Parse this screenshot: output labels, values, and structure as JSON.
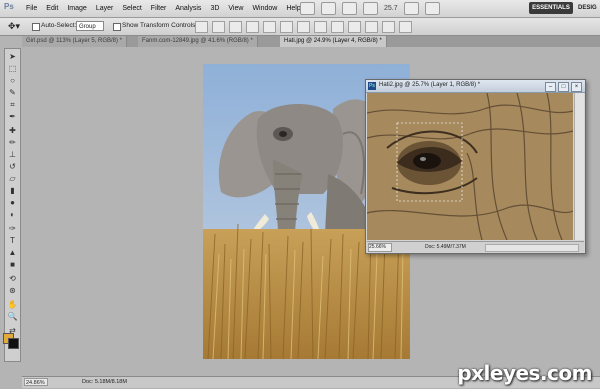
{
  "app": {
    "logo": "Ps"
  },
  "menu": [
    "File",
    "Edit",
    "Image",
    "Layer",
    "Select",
    "Filter",
    "Analysis",
    "3D",
    "View",
    "Window",
    "Help"
  ],
  "menu_zoom": "25.7",
  "workspace": {
    "active": "ESSENTIALS",
    "next": "DESIG"
  },
  "options": {
    "auto_select_label": "Auto-Select:",
    "auto_select_value": "Group",
    "transform_label": "Show Transform Controls"
  },
  "tabs": [
    "Girl.psd @ 113% (Layer 5, RGB/8) *",
    "Fanm.com-12849.jpg @ 41.6% (RGB/8) *",
    "Hati.jpg @ 24.9% (Layer 4, RGB/8) *"
  ],
  "main_status": {
    "zoom": "24.86%",
    "doc": "Doc: 5.18M/8.18M"
  },
  "sub_window": {
    "title": "Hati2.jpg @ 25.7% (Layer 1, RGB/8) *",
    "zoom": "25.66%",
    "doc": "Doc: 5.49M/7.37M"
  },
  "colors": {
    "foreground": "#e2a93b",
    "background": "#111111",
    "essentials_bg": "#3a3a3a"
  },
  "icons": [
    "move-tool-icon",
    "marquee-tool-icon",
    "lasso-tool-icon",
    "quick-select-icon",
    "crop-tool-icon",
    "eyedropper-icon",
    "healing-brush-icon",
    "brush-tool-icon",
    "clone-stamp-icon",
    "history-brush-icon",
    "eraser-icon",
    "gradient-icon",
    "blur-icon",
    "dodge-icon",
    "pen-tool-icon",
    "type-tool-icon",
    "path-select-icon",
    "shape-tool-icon",
    "3d-rotate-icon",
    "3d-orbit-icon",
    "hand-tool-icon",
    "zoom-tool-icon"
  ],
  "watermark": "pxleyes.com"
}
